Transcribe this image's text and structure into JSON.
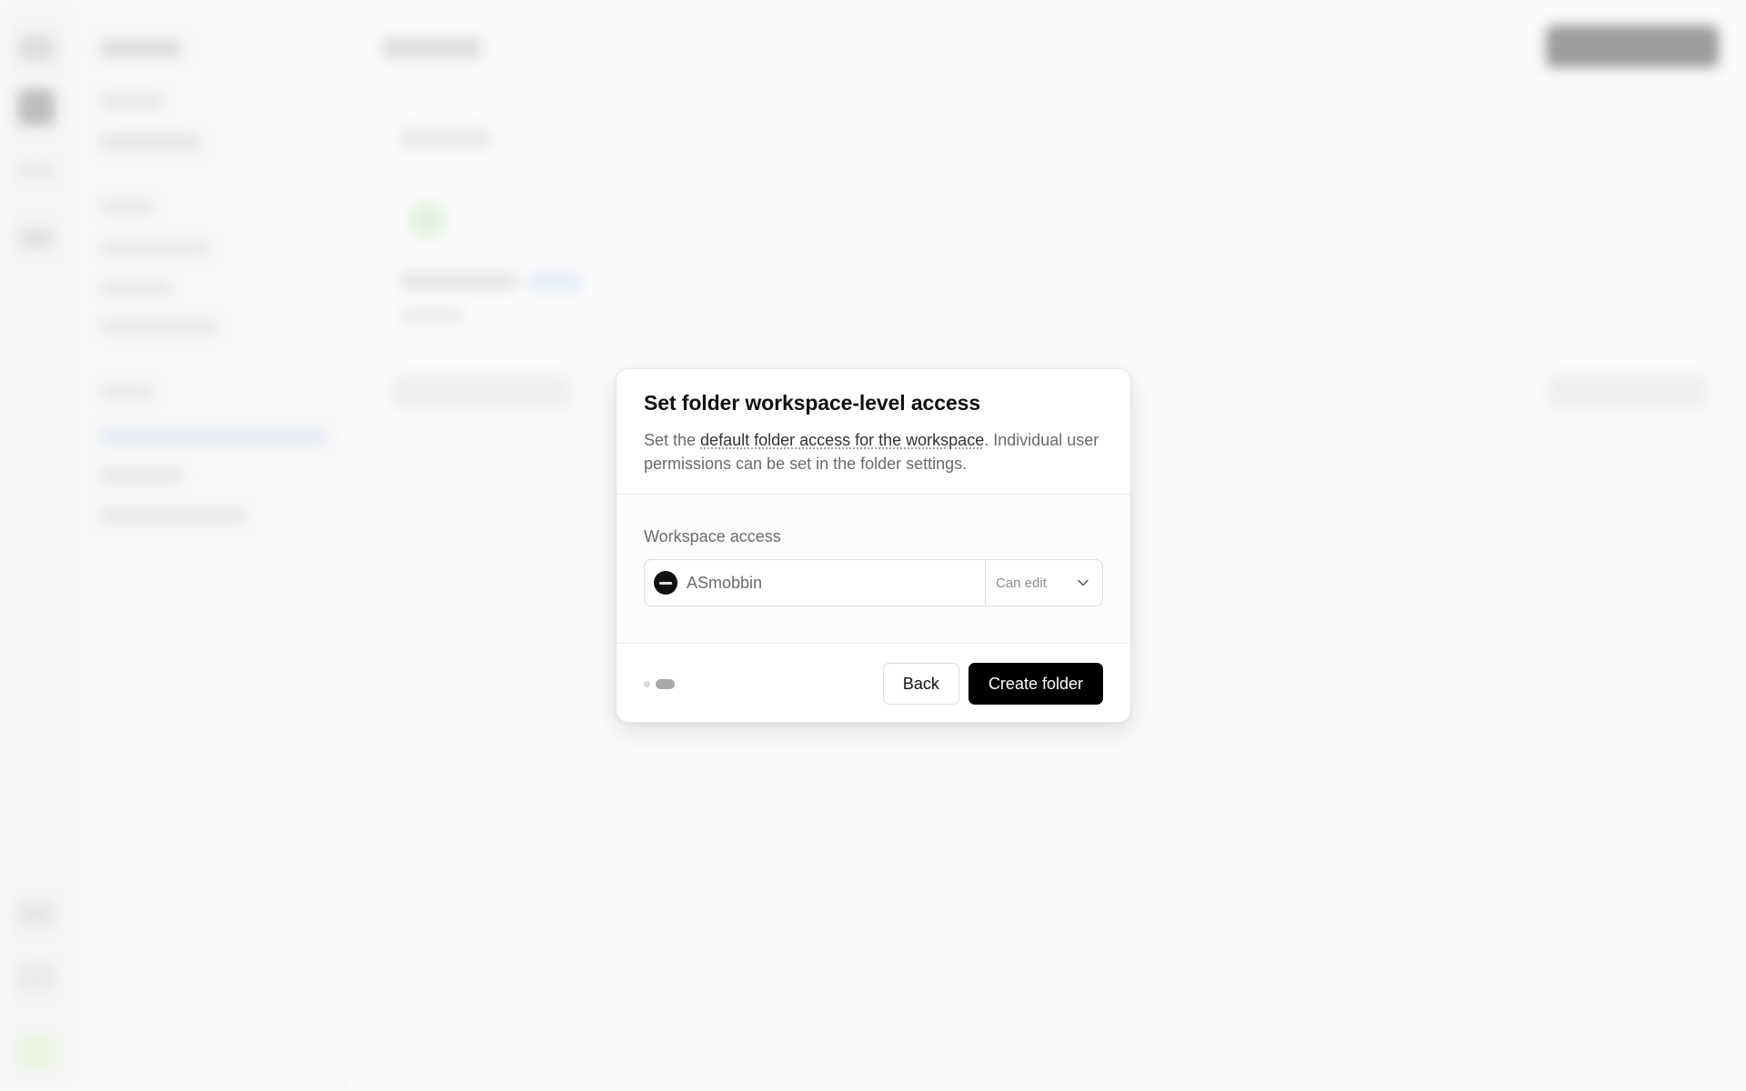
{
  "modal": {
    "title": "Set folder workspace-level access",
    "desc_prefix": "Set the ",
    "desc_link": "default folder access for the workspace",
    "desc_suffix": ". Individual user permissions can be set in the folder settings.",
    "field_label": "Workspace access",
    "workspace_name": "ASmobbin",
    "permission_value": "Can edit",
    "step_current": 2,
    "step_total": 2,
    "back_label": "Back",
    "create_label": "Create folder"
  },
  "colors": {
    "primary_button": "#000000",
    "overlay": "#fafafa"
  }
}
